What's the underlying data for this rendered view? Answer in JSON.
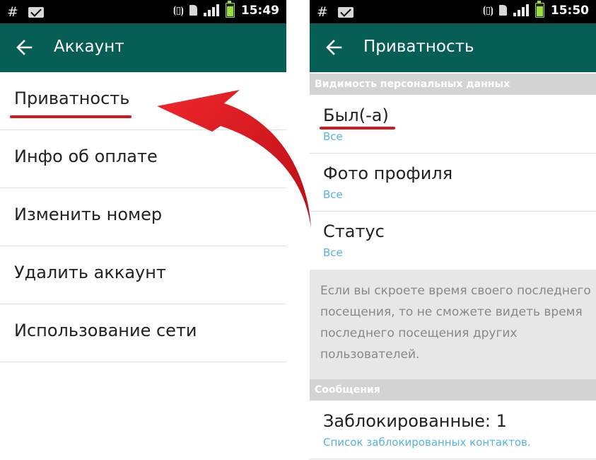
{
  "left_screen": {
    "status": {
      "time": "15:49",
      "hash": "#"
    },
    "actionbar": {
      "title": "Аккаунт"
    },
    "items": [
      {
        "label": "Приватность"
      },
      {
        "label": "Инфо об оплате"
      },
      {
        "label": "Изменить номер"
      },
      {
        "label": "Удалить аккаунт"
      },
      {
        "label": "Использование сети"
      }
    ]
  },
  "right_screen": {
    "status": {
      "time": "15:50",
      "hash": "#"
    },
    "actionbar": {
      "title": "Приватность"
    },
    "sections": [
      {
        "header": "Видимость персональных данных"
      },
      {
        "header": "Сообщения"
      }
    ],
    "prefs": [
      {
        "title": "Был(-а)",
        "summary": "Все"
      },
      {
        "title": "Фото профиля",
        "summary": "Все"
      },
      {
        "title": "Статус",
        "summary": "Все"
      },
      {
        "title": "Заблокированные: 1",
        "summary": "Список заблокированных контактов."
      }
    ],
    "note": "Если вы скроете время своего последнего посещения, то не сможете видеть время последнего посещения других пользователей."
  },
  "colors": {
    "actionbar": "#075e54",
    "section_header": "#d3d3d3",
    "summary": "#55b3e0",
    "annotation": "#d8171d"
  },
  "icons": {
    "back": "arrow-left-icon",
    "mail": "mail-icon",
    "vibrate": "vibrate-icon",
    "sim": "sim-card-icon",
    "signal": "signal-icon",
    "battery": "battery-icon"
  }
}
